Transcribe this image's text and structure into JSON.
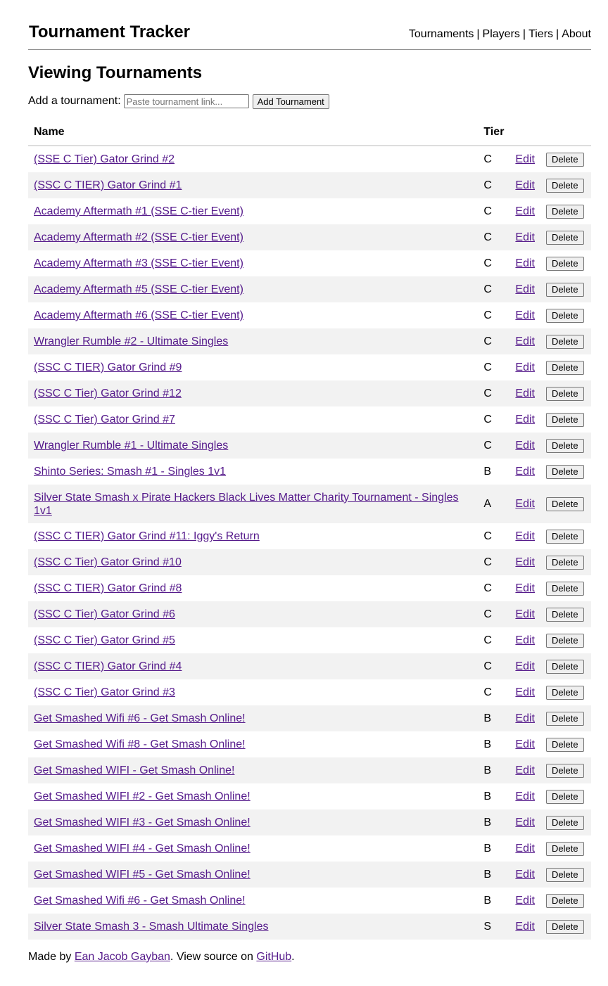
{
  "header": {
    "title": "Tournament Tracker",
    "nav": [
      "Tournaments",
      "Players",
      "Tiers",
      "About"
    ],
    "separator": "|"
  },
  "main": {
    "title": "Viewing Tournaments",
    "add_label": "Add a tournament:",
    "add_placeholder": "Paste tournament link...",
    "add_button": "Add Tournament",
    "columns": {
      "name": "Name",
      "tier": "Tier"
    },
    "edit_label": "Edit",
    "delete_label": "Delete",
    "rows": [
      {
        "name": "(SSE C Tier) Gator Grind #2",
        "tier": "C"
      },
      {
        "name": "(SSC C TIER) Gator Grind #1",
        "tier": "C"
      },
      {
        "name": "Academy Aftermath #1 (SSE C-tier Event)",
        "tier": "C"
      },
      {
        "name": "Academy Aftermath #2 (SSE C-tier Event)",
        "tier": "C"
      },
      {
        "name": "Academy Aftermath #3 (SSE C-tier Event)",
        "tier": "C"
      },
      {
        "name": "Academy Aftermath #5 (SSE C-tier Event)",
        "tier": "C"
      },
      {
        "name": "Academy Aftermath #6 (SSE C-tier Event)",
        "tier": "C"
      },
      {
        "name": "Wrangler Rumble #2 - Ultimate Singles",
        "tier": "C"
      },
      {
        "name": "(SSC C TIER) Gator Grind #9",
        "tier": "C"
      },
      {
        "name": "(SSC C Tier) Gator Grind #12",
        "tier": "C"
      },
      {
        "name": "(SSC C Tier) Gator Grind #7",
        "tier": "C"
      },
      {
        "name": "Wrangler Rumble #1 - Ultimate Singles",
        "tier": "C"
      },
      {
        "name": "Shinto Series: Smash #1 - Singles 1v1",
        "tier": "B"
      },
      {
        "name": "Silver State Smash x Pirate Hackers Black Lives Matter Charity Tournament - Singles 1v1",
        "tier": "A"
      },
      {
        "name": "(SSC C TIER) Gator Grind #11: Iggy's Return",
        "tier": "C"
      },
      {
        "name": "(SSC C Tier) Gator Grind #10",
        "tier": "C"
      },
      {
        "name": "(SSC C TIER) Gator Grind #8",
        "tier": "C"
      },
      {
        "name": "(SSC C Tier) Gator Grind #6",
        "tier": "C"
      },
      {
        "name": "(SSC C Tier) Gator Grind #5",
        "tier": "C"
      },
      {
        "name": "(SSC C TIER) Gator Grind #4",
        "tier": "C"
      },
      {
        "name": "(SSC C Tier) Gator Grind #3",
        "tier": "C"
      },
      {
        "name": "Get Smashed Wifi #6 - Get Smash Online!",
        "tier": "B"
      },
      {
        "name": "Get Smashed Wifi #8 - Get Smash Online!",
        "tier": "B"
      },
      {
        "name": "Get Smashed WIFI - Get Smash Online!",
        "tier": "B"
      },
      {
        "name": "Get Smashed WIFI #2 - Get Smash Online!",
        "tier": "B"
      },
      {
        "name": "Get Smashed WIFI #3 - Get Smash Online!",
        "tier": "B"
      },
      {
        "name": "Get Smashed WIFI #4 - Get Smash Online!",
        "tier": "B"
      },
      {
        "name": "Get Smashed WIFI #5 - Get Smash Online!",
        "tier": "B"
      },
      {
        "name": "Get Smashed Wifi #6 - Get Smash Online!",
        "tier": "B"
      },
      {
        "name": "Silver State Smash 3 - Smash Ultimate Singles",
        "tier": "S"
      }
    ]
  },
  "footer": {
    "made_by": "Made by",
    "author": "Ean Jacob Gayban",
    "view_source": ". View source on",
    "source_link": "GitHub",
    "end": "."
  }
}
